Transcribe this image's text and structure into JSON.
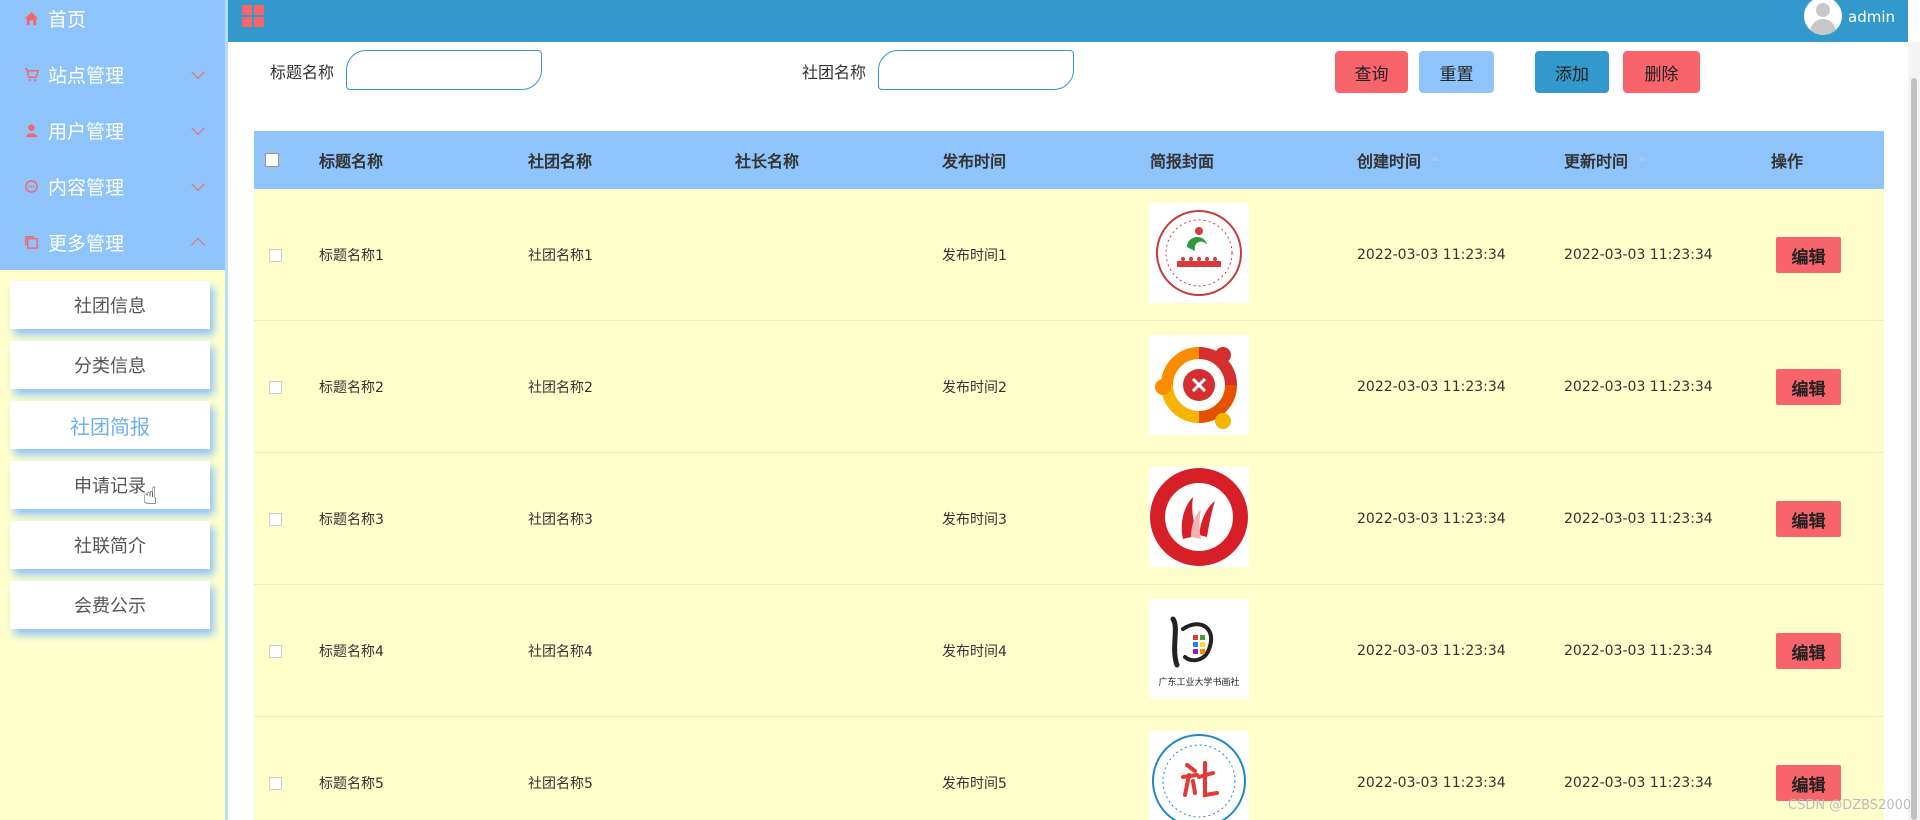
{
  "sidebar": {
    "menu": [
      {
        "label": "首页",
        "icon": "home-icon"
      },
      {
        "label": "站点管理",
        "icon": "cart-icon"
      },
      {
        "label": "用户管理",
        "icon": "user-icon"
      },
      {
        "label": "内容管理",
        "icon": "chat-icon"
      },
      {
        "label": "更多管理",
        "icon": "copy-icon"
      }
    ],
    "submenu": [
      {
        "label": "社团信息"
      },
      {
        "label": "分类信息"
      },
      {
        "label": "社团简报",
        "active": true
      },
      {
        "label": "申请记录"
      },
      {
        "label": "社联简介"
      },
      {
        "label": "会费公示"
      }
    ]
  },
  "header": {
    "username": "admin"
  },
  "search": {
    "title_label": "标题名称",
    "title_value": "",
    "club_label": "社团名称",
    "club_value": "",
    "query_label": "查询",
    "reset_label": "重置",
    "add_label": "添加",
    "delete_label": "删除"
  },
  "table": {
    "columns": [
      "标题名称",
      "社团名称",
      "社长名称",
      "发布时间",
      "简报封面",
      "创建时间",
      "更新时间",
      "操作"
    ],
    "rows": [
      {
        "title": "标题名称1",
        "club": "社团名称1",
        "president": "",
        "publish": "发布时间1",
        "cover": "logo-green-red-circle",
        "created": "2022-03-03 11:23:34",
        "updated": "2022-03-03 11:23:34",
        "action": "编辑"
      },
      {
        "title": "标题名称2",
        "club": "社团名称2",
        "president": "",
        "publish": "发布时间2",
        "cover": "logo-orange-ring",
        "created": "2022-03-03 11:23:34",
        "updated": "2022-03-03 11:23:34",
        "action": "编辑"
      },
      {
        "title": "标题名称3",
        "club": "社团名称3",
        "president": "",
        "publish": "发布时间3",
        "cover": "logo-red-union",
        "created": "2022-03-03 11:23:34",
        "updated": "2022-03-03 11:23:34",
        "action": "编辑"
      },
      {
        "title": "标题名称4",
        "club": "社团名称4",
        "president": "",
        "publish": "发布时间4",
        "cover": "logo-calligraphy",
        "created": "2022-03-03 11:23:34",
        "updated": "2022-03-03 11:23:34",
        "action": "编辑"
      },
      {
        "title": "标题名称5",
        "club": "社团名称5",
        "president": "",
        "publish": "发布时间5",
        "cover": "logo-blue-circle",
        "created": "2022-03-03 11:23:34",
        "updated": "2022-03-03 11:23:34",
        "action": "编辑"
      }
    ],
    "cover_logo_texts": {
      "logo4": "广东工业大学书画社"
    }
  },
  "watermark": "CSDN @DZBS2000",
  "colors": {
    "primary": "#3399cc",
    "light_blue": "#8fc4fb",
    "accent_red": "#f8646c",
    "row_yellow": "#ffffcc"
  }
}
